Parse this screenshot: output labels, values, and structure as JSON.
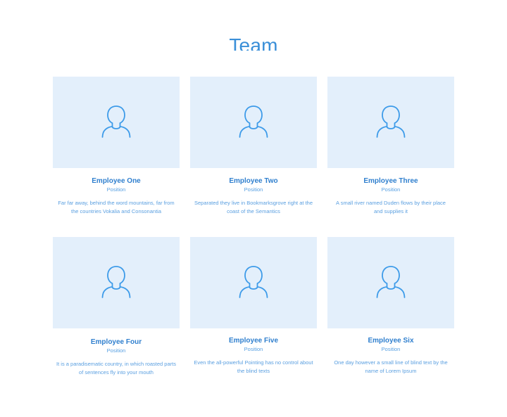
{
  "section": {
    "title": "Team"
  },
  "colors": {
    "accent": "#3a8fd8",
    "card_background": "#e3effb",
    "icon_stroke": "#3d9be9"
  },
  "employees": [
    {
      "name": "Employee One",
      "position": "Position",
      "bio": "Far far away, behind the word mountains, far from the countries Vokalia and Consonantia",
      "icon": "person-icon"
    },
    {
      "name": "Employee Two",
      "position": "Position",
      "bio": "Separated they live in Bookmarksgrove right at the coast of the Semantics",
      "icon": "person-icon"
    },
    {
      "name": "Employee Three",
      "position": "Position",
      "bio": "A small river named Duden flows by their place and supplies it",
      "icon": "person-icon"
    },
    {
      "name": "Employee Four",
      "position": "Position",
      "bio": "It is a paradisematic country, in which roasted parts of sentences fly into your mouth",
      "icon": "person-icon"
    },
    {
      "name": "Employee Five",
      "position": "Position",
      "bio": "Even the all-powerful Pointing has no control about the blind texts",
      "icon": "person-icon"
    },
    {
      "name": "Employee Six",
      "position": "Position",
      "bio": "One day however a small line of blind text by the name of Lorem Ipsum",
      "icon": "person-icon"
    }
  ]
}
